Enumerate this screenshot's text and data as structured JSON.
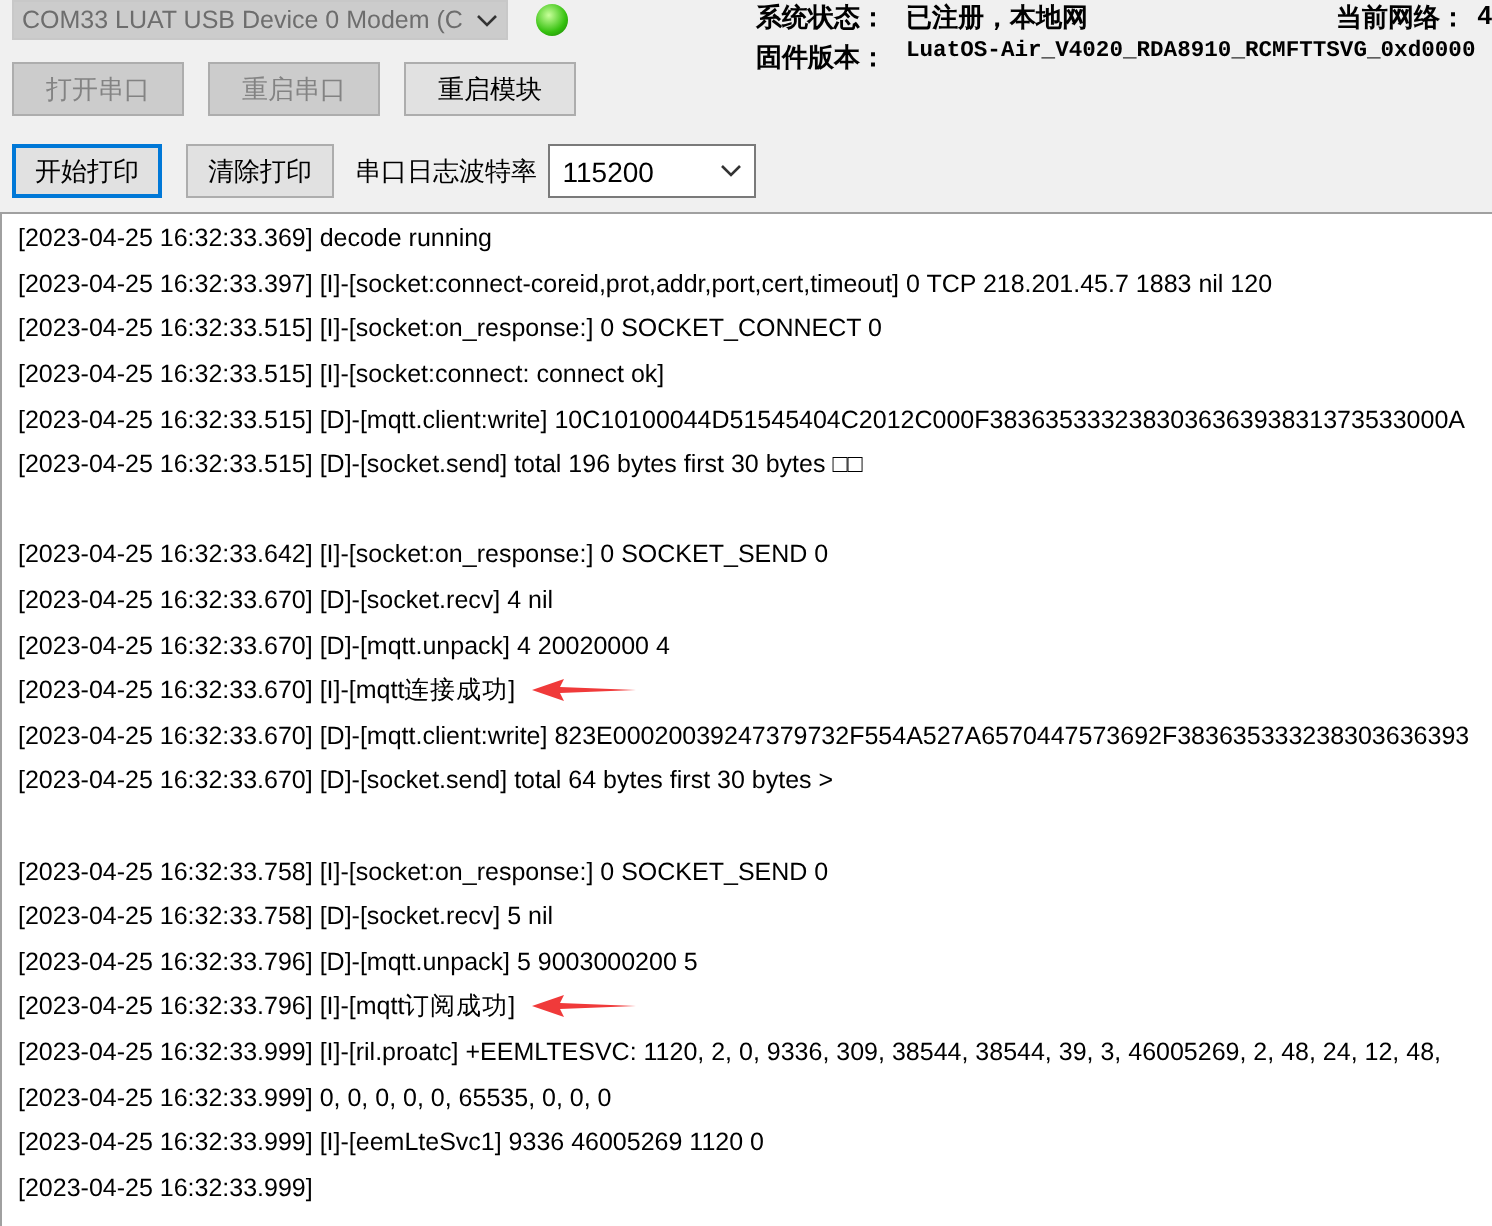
{
  "port_select": {
    "value": "COM33 LUAT USB Device 0 Modem (C",
    "disabled": true
  },
  "status_led": {
    "on": true
  },
  "info": [
    {
      "label": "系统状态：",
      "value": "已注册，本地网"
    },
    {
      "label": "当前网络：",
      "value": "4"
    },
    {
      "label": "固件版本：",
      "value": "LuatOS-Air_V4020_RDA8910_RCMFTTSVG_0xd0000"
    }
  ],
  "buttons_row1": [
    {
      "label": "打开串口",
      "disabled": true
    },
    {
      "label": "重启串口",
      "disabled": true
    },
    {
      "label": "重启模块",
      "disabled": false
    }
  ],
  "buttons_row2": [
    {
      "label": "开始打印",
      "focused": true
    },
    {
      "label": "清除打印",
      "focused": false
    }
  ],
  "baud": {
    "label": "串口日志波特率",
    "value": "115200"
  },
  "log": [
    {
      "kind": "line",
      "text": "[2023-04-25 16:32:33.369] decode running"
    },
    {
      "kind": "line",
      "text": "[2023-04-25 16:32:33.397] [I]-[socket:connect-coreid,prot,addr,port,cert,timeout] 0 TCP 218.201.45.7 1883 nil 120"
    },
    {
      "kind": "line",
      "text": "[2023-04-25 16:32:33.515] [I]-[socket:on_response:] 0 SOCKET_CONNECT 0"
    },
    {
      "kind": "line",
      "text": "[2023-04-25 16:32:33.515] [I]-[socket:connect: connect ok]"
    },
    {
      "kind": "line",
      "text": "[2023-04-25 16:32:33.515] [D]-[mqtt.client:write] 10C10100044D51545404C2012C000F383635333238303636393831373533000A"
    },
    {
      "kind": "line",
      "text": "[2023-04-25 16:32:33.515] [D]-[socket.send] total 196 bytes first 30 bytes □□"
    },
    {
      "kind": "blank"
    },
    {
      "kind": "line",
      "text": "[2023-04-25 16:32:33.642] [I]-[socket:on_response:] 0 SOCKET_SEND 0"
    },
    {
      "kind": "line",
      "text": "[2023-04-25 16:32:33.670] [D]-[socket.recv] 4 nil"
    },
    {
      "kind": "line",
      "text": "[2023-04-25 16:32:33.670] [D]-[mqtt.unpack] 4 20020000 4"
    },
    {
      "kind": "arrowed",
      "text": "[2023-04-25 16:32:33.670] [I]-[mqtt连接成功]"
    },
    {
      "kind": "line",
      "text": "[2023-04-25 16:32:33.670] [D]-[mqtt.client:write] 823E00020039247379732F554A527A6570447573692F383635333238303636393"
    },
    {
      "kind": "line",
      "text": "[2023-04-25 16:32:33.670] [D]-[socket.send] total 64 bytes first 30 bytes >"
    },
    {
      "kind": "blank"
    },
    {
      "kind": "line",
      "text": "[2023-04-25 16:32:33.758] [I]-[socket:on_response:] 0 SOCKET_SEND 0"
    },
    {
      "kind": "line",
      "text": "[2023-04-25 16:32:33.758] [D]-[socket.recv] 5 nil"
    },
    {
      "kind": "line",
      "text": "[2023-04-25 16:32:33.796] [D]-[mqtt.unpack] 5 9003000200 5"
    },
    {
      "kind": "arrowed",
      "text": "[2023-04-25 16:32:33.796] [I]-[mqtt订阅成功]"
    },
    {
      "kind": "line",
      "text": "[2023-04-25 16:32:33.999] [I]-[ril.proatc] +EEMLTESVC: 1120, 2, 0, 9336, 309, 38544, 38544, 39, 3, 46005269, 2, 48, 24, 12, 48,"
    },
    {
      "kind": "line",
      "text": "[2023-04-25 16:32:33.999] 0, 0, 0, 0, 0, 65535, 0, 0, 0"
    },
    {
      "kind": "line",
      "text": "[2023-04-25 16:32:33.999] [I]-[eemLteSvc1] 9336 46005269  1120 0"
    },
    {
      "kind": "line",
      "text": "[2023-04-25 16:32:33.999]"
    }
  ]
}
